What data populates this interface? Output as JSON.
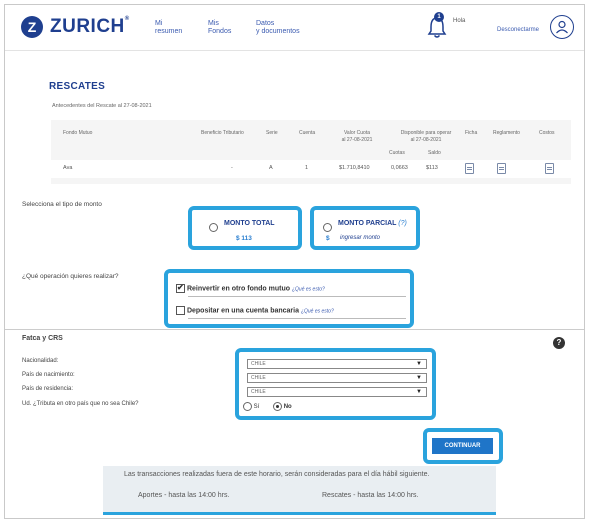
{
  "header": {
    "brand": "ZURICH",
    "brand_mark": "Z",
    "nav": [
      {
        "line1": "Mi",
        "line2": "resumen"
      },
      {
        "line1": "Mis",
        "line2": "Fondos"
      },
      {
        "line1": "Datos",
        "line2": "y documentos"
      }
    ],
    "notification_count": "1",
    "greeting": "Hola",
    "logout": "Desconectarme"
  },
  "rescates": {
    "title": "RESCATES",
    "subtitle": "Antecedentes del Rescate al 27-08-2021",
    "table": {
      "headers": {
        "fondo": "Fondo Mutuo",
        "beneficio": "Beneficio Tributario",
        "serie": "Serie",
        "cuenta": "Cuenta",
        "valor_l1": "Valor Cuota",
        "valor_l2": "al 27-08-2021",
        "disp_l1": "Disponible para operar",
        "disp_l2": "al 27-08-2021",
        "cuotas": "Cuotas",
        "saldo": "Saldo",
        "ficha": "Ficha",
        "reglamento": "Reglamento",
        "costos": "Costos"
      },
      "row": {
        "fondo": "Ava",
        "beneficio": "-",
        "serie": "A",
        "cuenta": "1",
        "valor": "$1.710,8410",
        "cuotas": "0,0663",
        "saldo": "$113"
      }
    }
  },
  "monto": {
    "label": "Selecciona el tipo de monto",
    "total_title": "MONTO TOTAL",
    "total_amount": "$ 113",
    "parcial_title": "MONTO PARCIAL",
    "parcial_help": "(?)",
    "parcial_currency": "$",
    "parcial_placeholder": "ingresar monto"
  },
  "operacion": {
    "label": "¿Qué operación quieres realizar?",
    "option1": "Reinvertir en otro fondo mutuo",
    "option2": "Depositar en una cuenta bancaria",
    "what_link": "¿Qué es esto?"
  },
  "fatca": {
    "title": "Fatca y CRS",
    "nacionalidad_label": "Nacionalidad:",
    "nacimiento_label": "País de nacimiento:",
    "residencia_label": "País de residencia:",
    "tributa_label": "Ud. ¿Tributa en otro país que no sea Chile?",
    "nacionalidad_value": "CHILE",
    "nacimiento_value": "CHILE",
    "residencia_value": "CHILE",
    "si": "Sí",
    "no": "No"
  },
  "actions": {
    "continuar": "CONTINUAR"
  },
  "info": {
    "line1": "Las transacciones realizadas fuera de este horario, serán consideradas para el día hábil siguiente.",
    "aportes": "Aportes - hasta las 14:00 hrs.",
    "rescates": "Rescates - hasta las 14:00 hrs."
  },
  "colors": {
    "brand": "#1f3f8f",
    "highlight": "#2aa3dd",
    "button": "#1f75c8"
  }
}
